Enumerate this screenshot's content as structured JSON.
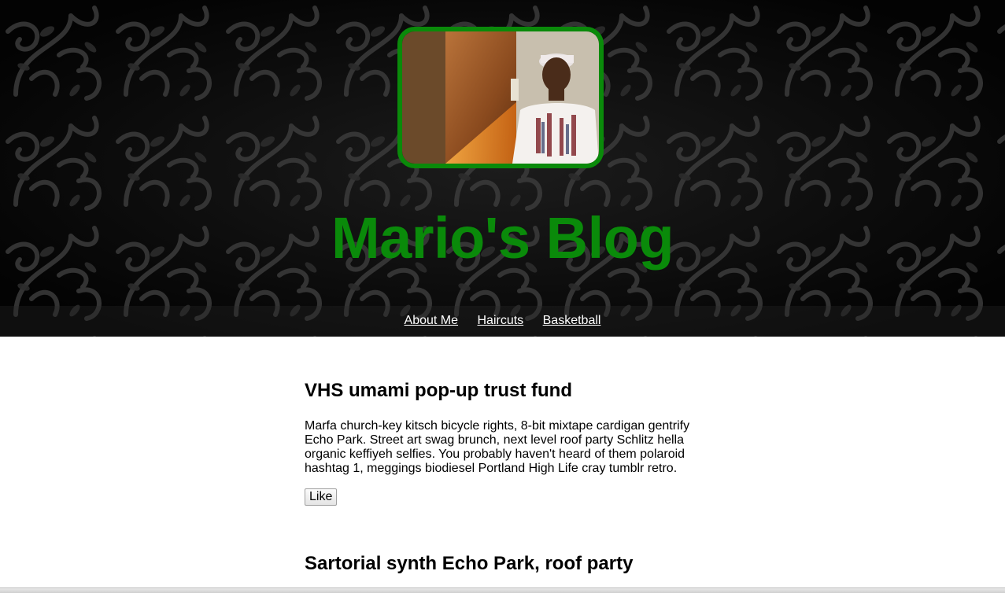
{
  "header": {
    "title": "Mario's Blog",
    "avatar_icon": "profile-photo",
    "accent_color": "#0a8a0a"
  },
  "nav": {
    "items": [
      {
        "label": "About Me"
      },
      {
        "label": "Haircuts"
      },
      {
        "label": "Basketball"
      }
    ]
  },
  "posts": [
    {
      "title": "VHS umami pop-up trust fund",
      "body_lines": [
        "Marfa church-key kitsch bicycle rights, 8-bit mixtape cardigan gentrify",
        "Echo Park. Street art swag brunch, next level roof party Schlitz hella",
        "organic keffiyeh selfies. You probably haven't heard of them polaroid",
        "hashtag 1, meggings biodiesel Portland High Life cray tumblr retro."
      ],
      "like_label": "Like"
    },
    {
      "title": "Sartorial synth Echo Park, roof party"
    }
  ]
}
